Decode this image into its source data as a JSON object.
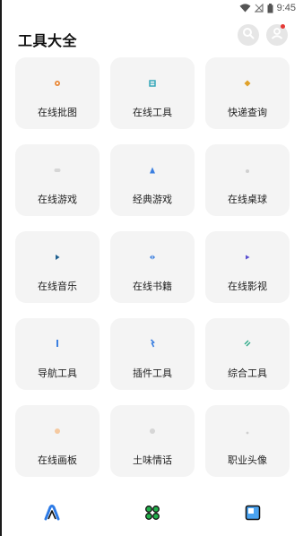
{
  "status_bar": {
    "time": "9:45"
  },
  "header": {
    "title": "工具大全"
  },
  "tools": [
    {
      "label": "在线批图",
      "icon": "image-edit-icon",
      "color": "#e8893a"
    },
    {
      "label": "在线工具",
      "icon": "toolbox-icon",
      "color": "#2aa3b6"
    },
    {
      "label": "快递查询",
      "icon": "package-icon",
      "color": "#e0a12a"
    },
    {
      "label": "在线游戏",
      "icon": "gamepad-icon",
      "color": "#cfcfcf"
    },
    {
      "label": "经典游戏",
      "icon": "joystick-icon",
      "color": "#3b7fe0"
    },
    {
      "label": "在线桌球",
      "icon": "billiard-icon",
      "color": "#d0d0d0"
    },
    {
      "label": "在线音乐",
      "icon": "music-icon",
      "color": "#1e5f8f"
    },
    {
      "label": "在线书籍",
      "icon": "book-icon",
      "color": "#3b7fe0"
    },
    {
      "label": "在线影视",
      "icon": "video-icon",
      "color": "#5a4fd0"
    },
    {
      "label": "导航工具",
      "icon": "compass-icon",
      "color": "#3b7fe0"
    },
    {
      "label": "插件工具",
      "icon": "plugin-icon",
      "color": "#3b7fe0"
    },
    {
      "label": "综合工具",
      "icon": "wrench-icon",
      "color": "#2eaa88"
    },
    {
      "label": "在线画板",
      "icon": "palette-icon",
      "color": "#f5c9a0"
    },
    {
      "label": "土味情话",
      "icon": "chat-heart-icon",
      "color": "#d0d0d0"
    },
    {
      "label": "职业头像",
      "icon": "portrait-icon",
      "color": "#d8d8d8"
    }
  ],
  "bottom_nav": [
    {
      "name": "home",
      "icon": "brand-a-icon"
    },
    {
      "name": "apps",
      "icon": "apps-grid-icon"
    },
    {
      "name": "me",
      "icon": "square-window-icon"
    }
  ],
  "colors": {
    "tile_bg": "#f4f4f4",
    "notification_dot": "#e53935"
  }
}
